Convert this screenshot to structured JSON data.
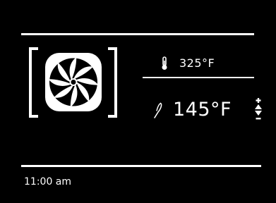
{
  "status": {
    "oven_temperature": "325°F",
    "probe_temperature": "145°F"
  },
  "footer": {
    "time": "11:00 am"
  },
  "icons": {
    "fan": "convection-fan-icon",
    "oven_temp": "thermometer-icon",
    "probe_temp": "meat-probe-icon",
    "stepper": "temperature-up-down-stepper"
  },
  "colors": {
    "background": "#000000",
    "foreground": "#ffffff"
  }
}
